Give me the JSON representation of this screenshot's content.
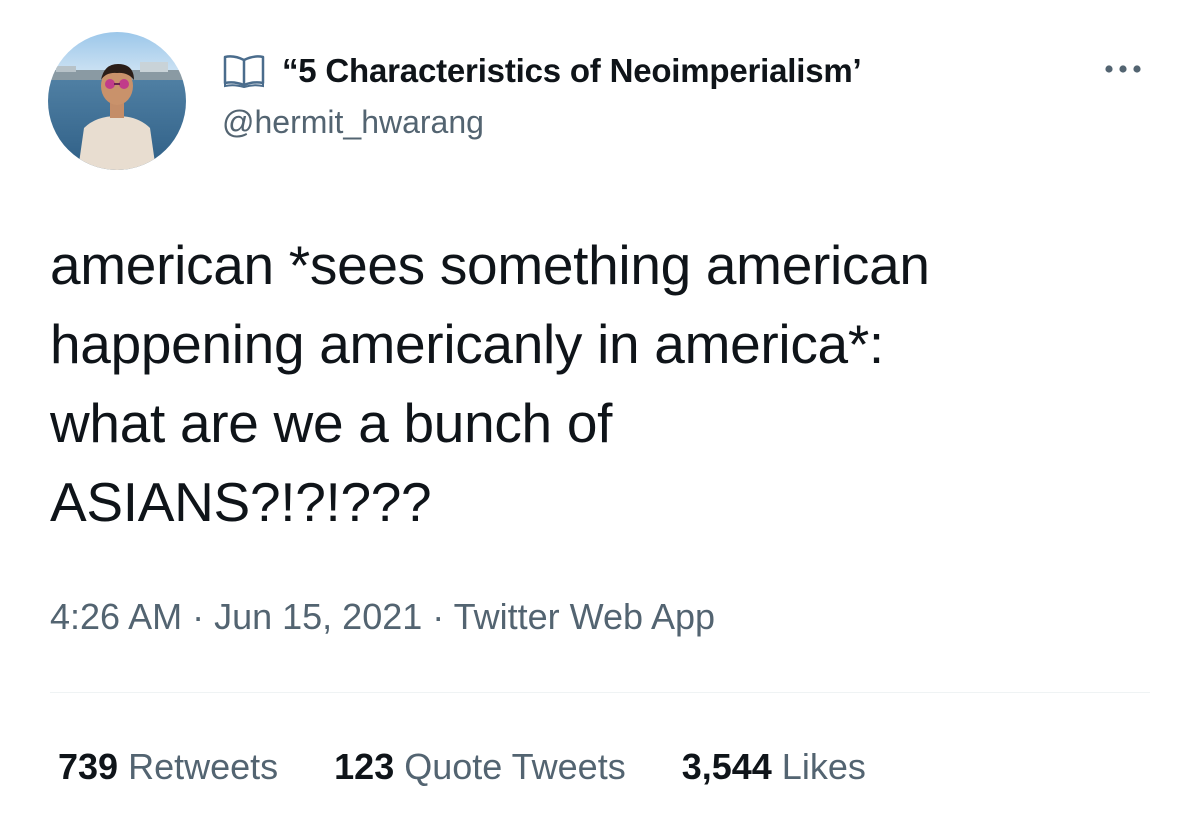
{
  "author": {
    "display_name": "“5 Characteristics of Neoimperialism’",
    "handle": "@hermit_hwarang"
  },
  "icons": {
    "name_emoji": "open-book-icon",
    "more": "more-dots-icon",
    "avatar": "profile-photo"
  },
  "tweet": {
    "lines": [
      "american *sees something american",
      "happening americanly in america*:",
      "what are we a bunch of",
      "ASIANS?!?!???"
    ]
  },
  "meta": {
    "time": "4:26 AM",
    "sep1": " · ",
    "date": "Jun 15, 2021",
    "sep2": " · ",
    "source": "Twitter Web App"
  },
  "stats": {
    "retweets_count": "739",
    "retweets_label": "Retweets",
    "quotes_count": "123",
    "quotes_label": "Quote Tweets",
    "likes_count": "3,544",
    "likes_label": "Likes"
  },
  "colors": {
    "text_primary": "#0f1419",
    "text_secondary": "#536471",
    "divider": "#eff3f4"
  }
}
